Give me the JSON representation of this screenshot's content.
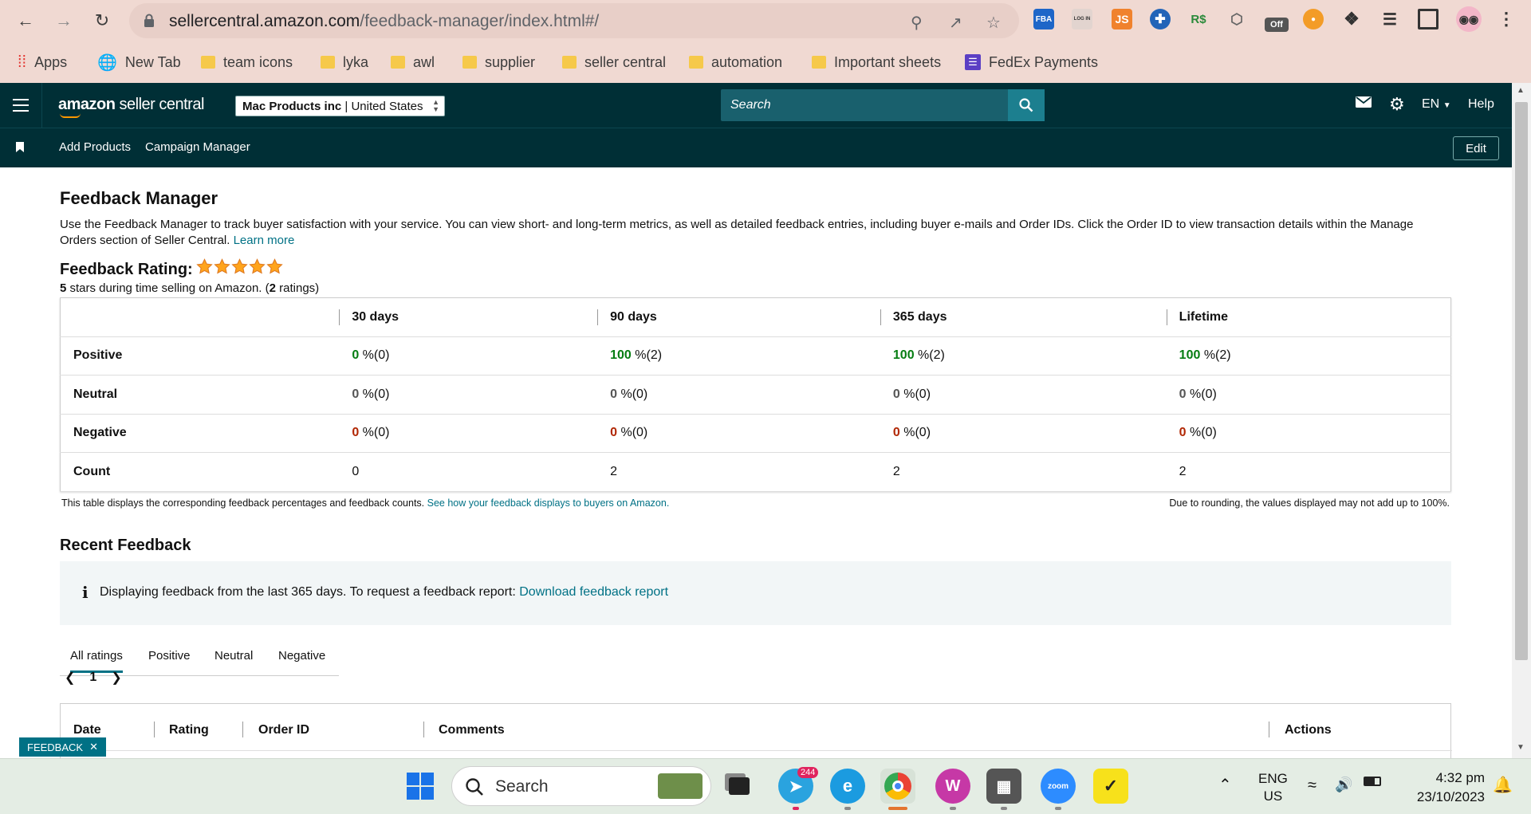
{
  "browser": {
    "url_host": "sellercentral.amazon.com",
    "url_path": "/feedback-manager/index.html#/",
    "extensions": [
      {
        "name": "fba-extension-icon",
        "label": "FBA",
        "color": "#1e66c8"
      },
      {
        "name": "login-extension-icon",
        "label": "LOG IN",
        "color": "#dfe3e8"
      },
      {
        "name": "js-extension-icon",
        "label": "JS",
        "color": "#f0822d"
      },
      {
        "name": "cross-extension-icon",
        "label": "",
        "color": "#2264b8"
      },
      {
        "name": "rs-extension-icon",
        "label": "R$",
        "color": "#2a8a3a"
      },
      {
        "name": "off-extension-icon",
        "label": "Off",
        "color": "#555555"
      }
    ],
    "bookmarks": [
      {
        "label": "Apps",
        "icon": "apps-grid-icon"
      },
      {
        "label": "New Tab",
        "icon": "globe-icon"
      },
      {
        "label": "team icons",
        "icon": "folder-icon"
      },
      {
        "label": "lyka",
        "icon": "folder-icon"
      },
      {
        "label": "awl",
        "icon": "folder-icon"
      },
      {
        "label": "supplier",
        "icon": "folder-icon"
      },
      {
        "label": "seller central",
        "icon": "folder-icon"
      },
      {
        "label": "automation",
        "icon": "folder-icon"
      },
      {
        "label": "Important sheets",
        "icon": "folder-icon"
      },
      {
        "label": "FedEx Payments",
        "icon": "list-icon"
      }
    ]
  },
  "header": {
    "logo_bold": "amazon",
    "logo_rest": " seller central",
    "account_name": "Mac Products inc",
    "account_region": "United States",
    "search_placeholder": "Search",
    "language": "EN",
    "help_label": "Help",
    "sub_nav": [
      "Add Products",
      "Campaign Manager"
    ],
    "edit_label": "Edit"
  },
  "page": {
    "title": "Feedback Manager",
    "description": "Use the Feedback Manager to track buyer satisfaction with your service. You can view short- and long-term metrics, as well as detailed feedback entries, including buyer e-mails and Order IDs. Click the Order ID to view transaction details within the Manage Orders section of Seller Central.",
    "learn_more": "Learn more",
    "rating_title": "Feedback Rating:",
    "rating_stars": 5,
    "rating_summary_stars": "5",
    "rating_summary_mid": " stars during time selling on Amazon. (",
    "rating_summary_count": "2",
    "rating_summary_end": " ratings)",
    "table": {
      "columns": [
        "30 days",
        "90 days",
        "365 days",
        "Lifetime"
      ],
      "rows": [
        {
          "label": "Positive",
          "cells": [
            {
              "pct": "0",
              "rest": " %(0)",
              "tone": "green"
            },
            {
              "pct": "100",
              "rest": " %(2)",
              "tone": "green"
            },
            {
              "pct": "100",
              "rest": " %(2)",
              "tone": "green"
            },
            {
              "pct": "100",
              "rest": " %(2)",
              "tone": "green"
            }
          ]
        },
        {
          "label": "Neutral",
          "cells": [
            {
              "pct": "0",
              "rest": " %(0)",
              "tone": "grey"
            },
            {
              "pct": "0",
              "rest": " %(0)",
              "tone": "grey"
            },
            {
              "pct": "0",
              "rest": " %(0)",
              "tone": "grey"
            },
            {
              "pct": "0",
              "rest": " %(0)",
              "tone": "grey"
            }
          ]
        },
        {
          "label": "Negative",
          "cells": [
            {
              "pct": "0",
              "rest": " %(0)",
              "tone": "red"
            },
            {
              "pct": "0",
              "rest": " %(0)",
              "tone": "red"
            },
            {
              "pct": "0",
              "rest": " %(0)",
              "tone": "red"
            },
            {
              "pct": "0",
              "rest": " %(0)",
              "tone": "red"
            }
          ]
        },
        {
          "label": "Count",
          "cells": [
            {
              "pct": "",
              "rest": "0",
              "tone": "plain"
            },
            {
              "pct": "",
              "rest": "2",
              "tone": "plain"
            },
            {
              "pct": "",
              "rest": "2",
              "tone": "plain"
            },
            {
              "pct": "",
              "rest": "2",
              "tone": "plain"
            }
          ]
        }
      ]
    },
    "table_note": "This table displays the corresponding feedback percentages and feedback counts.",
    "table_note_link": "See how your feedback displays to buyers on Amazon.",
    "rounding_note": "Due to rounding, the values displayed may not add up to 100%.",
    "recent_title": "Recent Feedback",
    "info_text": "Displaying feedback from the last 365 days. To request a feedback report:",
    "info_link": "Download feedback report",
    "tabs": [
      "All ratings",
      "Positive",
      "Neutral",
      "Negative"
    ],
    "page_number": "1",
    "list_columns": [
      "Date",
      "Rating",
      "Order ID",
      "Comments",
      "Actions"
    ],
    "feedback_tag": "FEEDBACK"
  },
  "taskbar": {
    "search_placeholder": "Search",
    "telegram_badge": "244",
    "lang_top": "ENG",
    "lang_bottom": "US",
    "time": "4:32 pm",
    "date": "23/10/2023"
  },
  "colors": {
    "header_bg": "#002f36",
    "link": "#007185",
    "positive": "#067d12",
    "negative": "#b12704",
    "chrome_bg": "#f0d9d2"
  }
}
